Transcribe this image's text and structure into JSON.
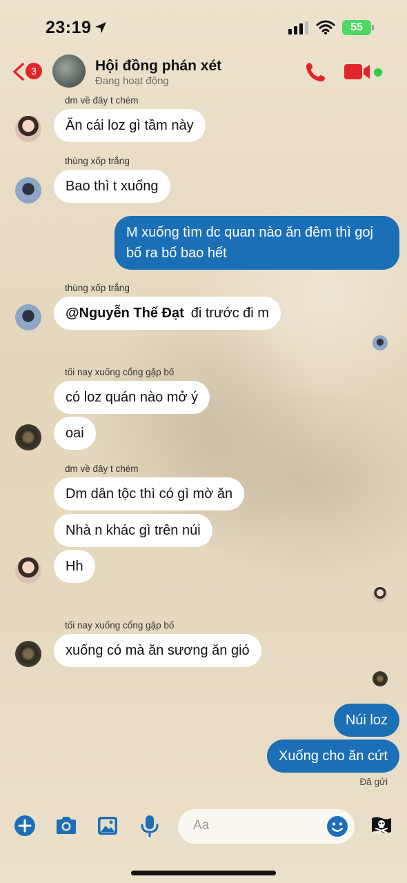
{
  "status": {
    "time": "23:19",
    "battery": "55"
  },
  "header": {
    "title": "Hội đồng phán xét",
    "subtitle": "Đang hoạt động",
    "unread_badge": "3"
  },
  "messages": [
    {
      "sender": "dm về đây t chém",
      "text": "Ăn cái loz gì tầm này"
    },
    {
      "sender": "thùng xốp trắng",
      "text": "Bao thì t xuống"
    },
    {
      "line1": "M xuống tìm dc quan nào ăn đêm thì goj",
      "line2": "bố ra bố bao hết"
    },
    {
      "sender": "thùng xốp trắng",
      "mention": "@Nguyễn Thế Đạt",
      "text": "đi trước đi m"
    },
    {
      "sender": "tối nay xuống cổng gặp bố",
      "text": "có loz quán nào mở ý"
    },
    {
      "text": "oai"
    },
    {
      "sender": "dm về đây t chém",
      "text": "Dm dân tộc thì có gì mờ ăn"
    },
    {
      "text": "Nhà n khác gì trên núi"
    },
    {
      "text": "Hh"
    },
    {
      "sender": "tối nay xuống cổng gặp bố",
      "text": "xuống có mà ăn sương ăn gió"
    },
    {
      "text": "Núi loz"
    },
    {
      "text": "Xuống cho ăn cứt"
    }
  ],
  "sent_status": "Đã gửi",
  "composer": {
    "placeholder": "Aa"
  },
  "colors": {
    "accent_red": "#e0262b",
    "outgoing_bubble": "#1b6fb6",
    "composer_icon": "#1b6fb6",
    "online": "#2ecc48"
  },
  "icons": [
    "location-arrow-icon",
    "signal-icon",
    "wifi-icon",
    "back-chevron-icon",
    "phone-icon",
    "video-icon",
    "plus-icon",
    "camera-icon",
    "image-icon",
    "microphone-icon",
    "emoji-icon",
    "pirate-flag-icon"
  ]
}
